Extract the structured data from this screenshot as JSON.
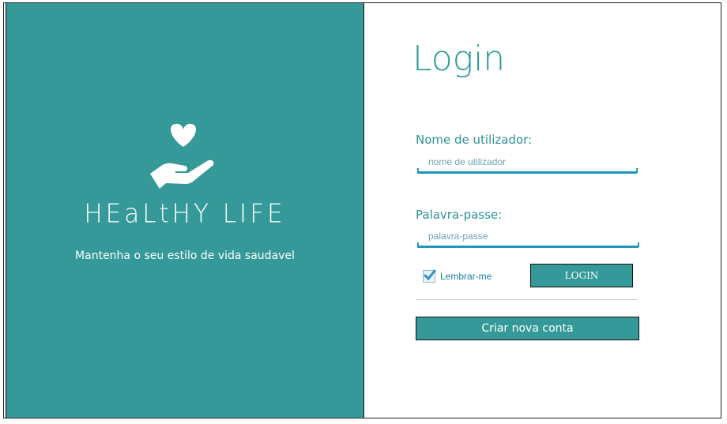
{
  "brand": {
    "name": "HEaLtHY LIFE",
    "tagline": "Mantenha o seu estilo de vida saudavel",
    "logo_icon": "heart-in-hand-icon"
  },
  "form": {
    "title": "Login",
    "username": {
      "label": "Nome de utilizador:",
      "placeholder": "nome de utilizador",
      "value": ""
    },
    "password": {
      "label": "Palavra-passe:",
      "placeholder": "palavra-passe",
      "value": ""
    },
    "remember": {
      "label": "Lembrar-me",
      "checked": true
    },
    "login_button": "LOGIN",
    "create_account_button": "Criar nova conta"
  },
  "colors": {
    "accent": "#349998",
    "input_underline": "#1f97bd",
    "label_text": "#2e9393"
  }
}
